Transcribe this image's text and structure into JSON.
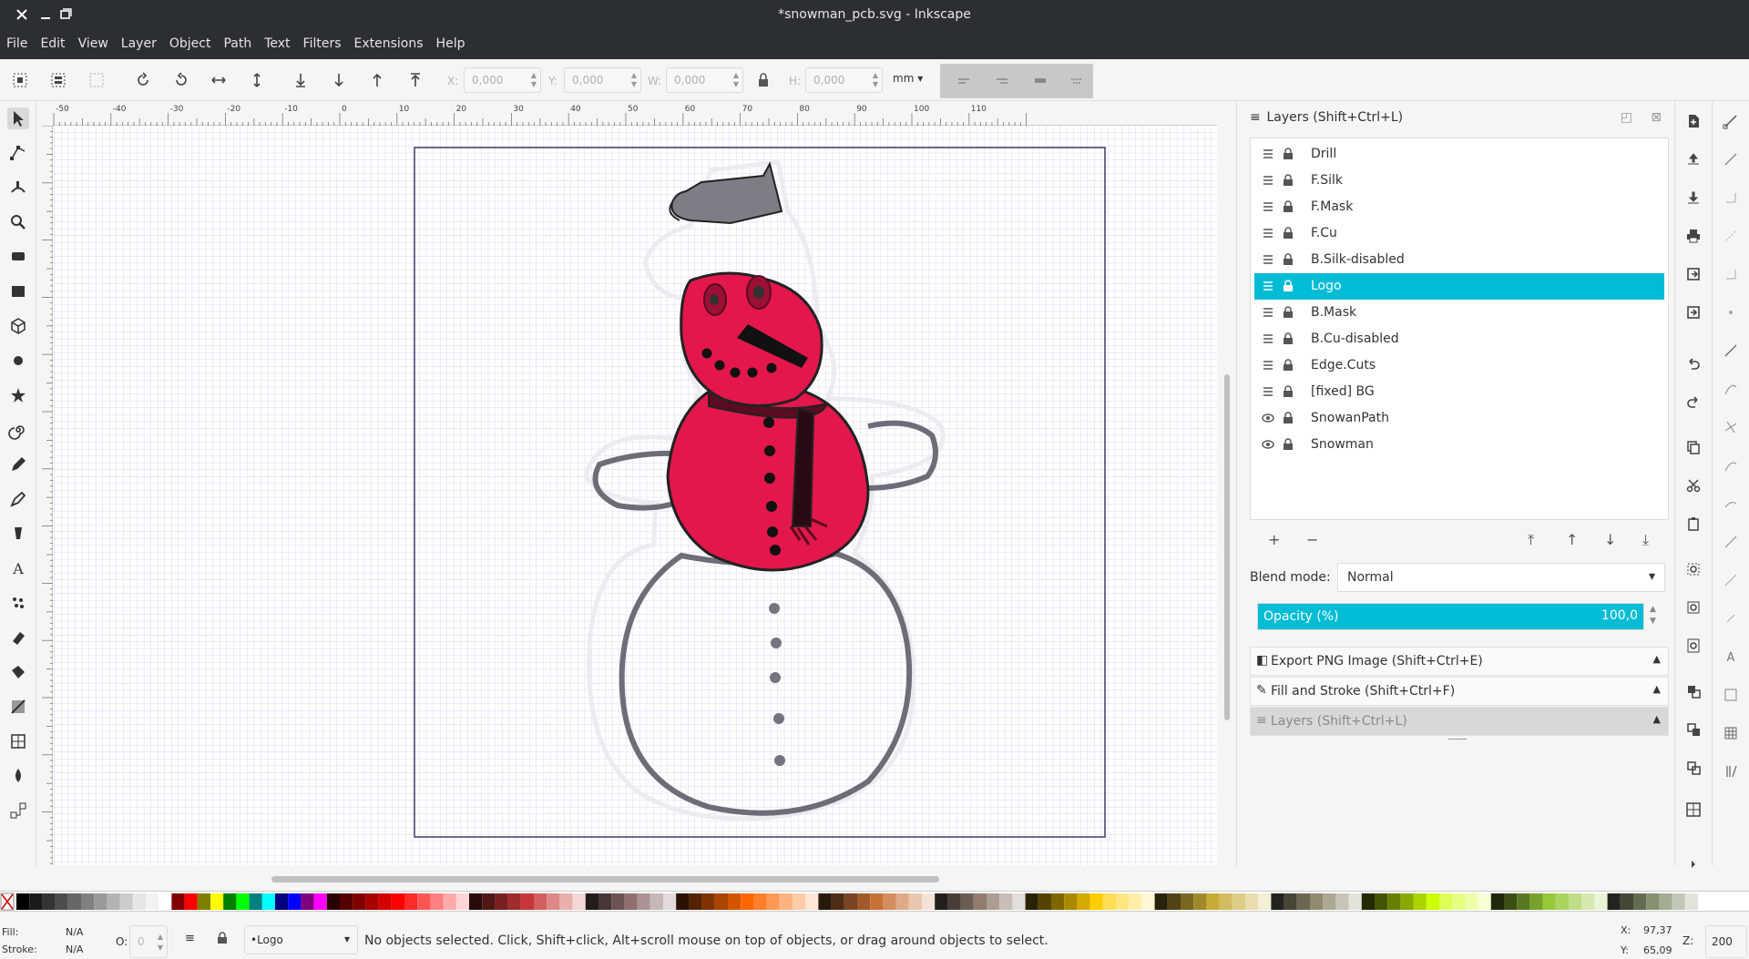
{
  "window": {
    "title": "*snowman_pcb.svg - Inkscape"
  },
  "menu": [
    "File",
    "Edit",
    "View",
    "Layer",
    "Object",
    "Path",
    "Text",
    "Filters",
    "Extensions",
    "Help"
  ],
  "toolbar": {
    "x_label": "X:",
    "x_value": "0,000",
    "y_label": "Y:",
    "y_value": "0,000",
    "w_label": "W:",
    "w_value": "0,000",
    "h_label": "H:",
    "h_value": "0,000",
    "unit": "mm"
  },
  "ruler": {
    "h_ticks": [
      "-50",
      "-40",
      "-30",
      "-20",
      "-10",
      "0",
      "10",
      "20",
      "30",
      "40",
      "50",
      "60",
      "70",
      "80",
      "90",
      "100",
      "110"
    ]
  },
  "layers_panel": {
    "title": "Layers (Shift+Ctrl+L)",
    "layers": [
      {
        "name": "Drill",
        "visible": false
      },
      {
        "name": "F.Silk",
        "visible": false
      },
      {
        "name": "F.Mask",
        "visible": false
      },
      {
        "name": "F.Cu",
        "visible": false
      },
      {
        "name": "B.Silk-disabled",
        "visible": false
      },
      {
        "name": "Logo",
        "visible": false,
        "selected": true
      },
      {
        "name": "B.Mask",
        "visible": false
      },
      {
        "name": "B.Cu-disabled",
        "visible": false
      },
      {
        "name": "Edge.Cuts",
        "visible": false
      },
      {
        "name": "[fixed] BG",
        "visible": false
      },
      {
        "name": "SnowanPath",
        "visible": true
      },
      {
        "name": "Snowman",
        "visible": true
      }
    ],
    "blend_label": "Blend mode:",
    "blend_value": "Normal",
    "opacity_label": "Opacity (%)",
    "opacity_value": "100,0",
    "opacity_level": 1.0
  },
  "docked_dialogs": [
    "Export PNG Image (Shift+Ctrl+E)",
    "Fill and Stroke (Shift+Ctrl+F)",
    "Layers (Shift+Ctrl+L)"
  ],
  "status": {
    "fill_label": "Fill:",
    "fill_value": "N/A",
    "stroke_label": "Stroke:",
    "stroke_value": "N/A",
    "opacity_label": "O:",
    "opacity_value": "0",
    "current_layer": "•Logo",
    "message": "No objects selected. Click, Shift+click, Alt+scroll mouse on top of objects, or drag around objects to select.",
    "x_label": "X:",
    "x_value": "97,37",
    "y_label": "Y:",
    "y_value": "65,09",
    "z_label": "Z:",
    "zoom_value": "200"
  },
  "colors": {
    "accent": "#00bcd4",
    "snowman_red": "#e3174b",
    "outline_grey": "#75757f",
    "hat_grey": "#7d7d86",
    "grid": "#c9c9f5"
  },
  "palette": [
    "#000000",
    "#1a1a1a",
    "#333333",
    "#4d4d4d",
    "#666666",
    "#808080",
    "#999999",
    "#b3b3b3",
    "#cccccc",
    "#e6e6e6",
    "#f2f2f2",
    "#ffffff",
    "#800000",
    "#ff0000",
    "#808000",
    "#ffff00",
    "#008000",
    "#00ff00",
    "#008080",
    "#00ffff",
    "#000080",
    "#0000ff",
    "#800080",
    "#ff00ff",
    "#2b0000",
    "#550000",
    "#800000",
    "#aa0000",
    "#d40000",
    "#ff0000",
    "#ff2a2a",
    "#ff5555",
    "#ff8080",
    "#ffaaaa",
    "#ffd5d5",
    "#280b0b",
    "#501616",
    "#782121",
    "#a02c2c",
    "#c83737",
    "#d35f5f",
    "#de8787",
    "#e9afaf",
    "#f4d7d7",
    "#241c1c",
    "#483737",
    "#6c5353",
    "#916f6f",
    "#ac9393",
    "#c8b7b7",
    "#e3dbdb",
    "#2b1100",
    "#552200",
    "#803300",
    "#aa4400",
    "#d45500",
    "#ff6600",
    "#ff7f2a",
    "#ff9955",
    "#ffb380",
    "#ffccaa",
    "#ffe6d5",
    "#28170b",
    "#502d16",
    "#784421",
    "#a05a2c",
    "#c87137",
    "#d38d5f",
    "#deaa87",
    "#e9c6af",
    "#f4e3d7",
    "#241f1c",
    "#483e37",
    "#6c5d53",
    "#917c6f",
    "#ac9d93",
    "#c8beb7",
    "#e3dedb",
    "#2b2200",
    "#554400",
    "#806600",
    "#aa8800",
    "#d4aa00",
    "#ffcc00",
    "#ffdd55",
    "#ffe680",
    "#ffeeaa",
    "#fff6d5",
    "#28220b",
    "#504416",
    "#786721",
    "#a0892c",
    "#c8ab37",
    "#d3bc5f",
    "#decd87",
    "#e9ddaf",
    "#f4eed7",
    "#24221c",
    "#484537",
    "#6c6753",
    "#918a6f",
    "#aca793",
    "#c8c4b7",
    "#e3e2db",
    "#222b00",
    "#445500",
    "#668000",
    "#88aa00",
    "#aad400",
    "#ccff00",
    "#ddff55",
    "#e5ff80",
    "#eeffaa",
    "#f6ffd5",
    "#1e280b",
    "#3c5016",
    "#5a7821",
    "#78a02c",
    "#96c837",
    "#abd35f",
    "#c0de87",
    "#d5e9af",
    "#eaf4d7",
    "#21241c",
    "#434837",
    "#646c53",
    "#85916f",
    "#a4ac93",
    "#c2c8b7",
    "#e1e3db"
  ]
}
